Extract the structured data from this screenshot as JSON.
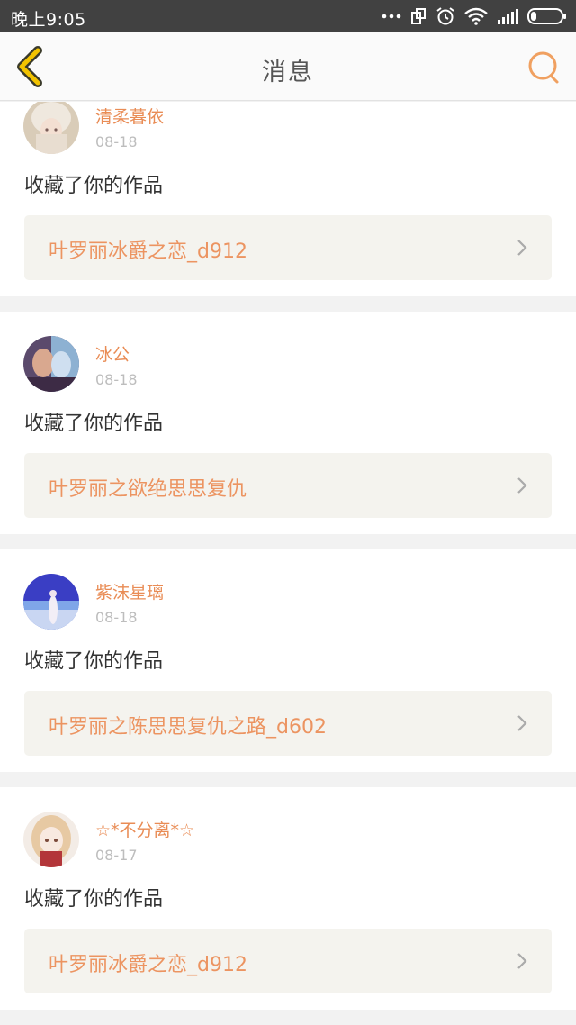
{
  "status_bar": {
    "time": "晚上9:05",
    "icons": [
      "more-dots-icon",
      "screen-rotate-icon",
      "alarm-icon",
      "wifi-icon",
      "signal-icon",
      "battery-icon"
    ]
  },
  "header": {
    "title": "消息",
    "back_icon": "chevron-left-icon",
    "search_icon": "search-icon",
    "accent_color": "#f2c300",
    "search_color": "#f0a060"
  },
  "messages": [
    {
      "user": "清柔暮依",
      "date": "08-18",
      "action": "收藏了你的作品",
      "work": "叶罗丽冰爵之恋_d912"
    },
    {
      "user": "冰公",
      "date": "08-18",
      "action": "收藏了你的作品",
      "work": "叶罗丽之欲绝思思复仇"
    },
    {
      "user": "紫沫星璃",
      "date": "08-18",
      "action": "收藏了你的作品",
      "work": "叶罗丽之陈思思复仇之路_d602"
    },
    {
      "user": "☆*不分离*☆",
      "date": "08-17",
      "action": "收藏了你的作品",
      "work": "叶罗丽冰爵之恋_d912"
    }
  ],
  "colors": {
    "username": "#e98c55",
    "work_title": "#ec9461",
    "work_bg": "#f4f3ee",
    "date": "#bdbdbd"
  }
}
